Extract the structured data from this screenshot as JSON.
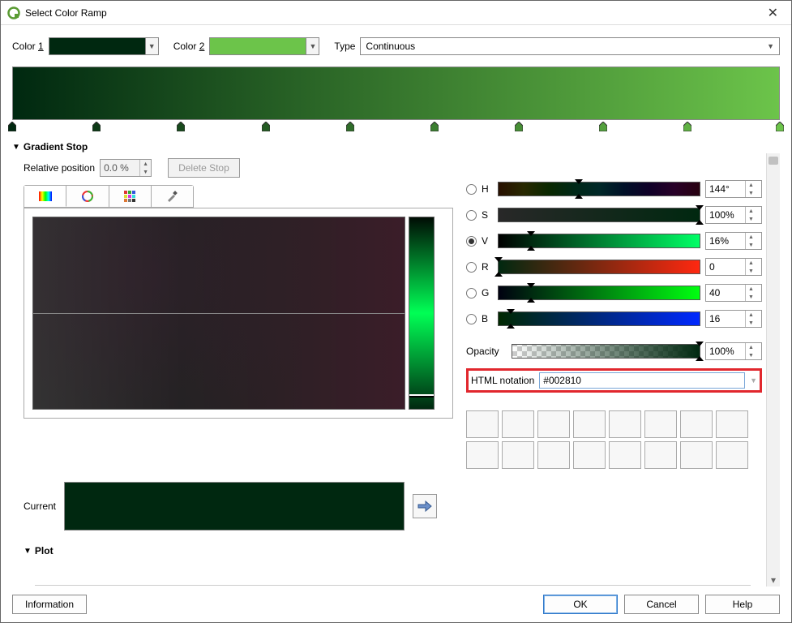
{
  "window": {
    "title": "Select Color Ramp"
  },
  "top": {
    "color1_label_pre": "Color ",
    "color1_u": "1",
    "color2_label_pre": "Color ",
    "color2_u": "2",
    "color1": "#002810",
    "color2": "#6cc44a",
    "type_label": "Type",
    "type_value": "Continuous"
  },
  "gradient": {
    "stops_pct": [
      0,
      11,
      22,
      33,
      44,
      55,
      66,
      77,
      88,
      100
    ]
  },
  "section1": {
    "title": "Gradient Stop"
  },
  "stop": {
    "relpos_label": "Relative position",
    "relpos_value": "0.0 %",
    "delete_label": "Delete Stop"
  },
  "channels": {
    "h": {
      "label": "H",
      "value": "144°",
      "grad": "linear-gradient(to right,#281000,#282800,#0a2800,#002817,#002828,#001028,#100028,#280028,#280010)",
      "mk": 40
    },
    "s": {
      "label": "S",
      "value": "100%",
      "grad": "linear-gradient(to right,#282828,#002810)",
      "mk": 100
    },
    "v": {
      "label": "V",
      "value": "16%",
      "grad": "linear-gradient(to right,#000000,#00ff66)",
      "mk": 16,
      "selected": true
    },
    "r": {
      "label": "R",
      "value": "0",
      "grad": "linear-gradient(to right,#002810,#ff2810)",
      "mk": 0
    },
    "g": {
      "label": "G",
      "value": "40",
      "grad": "linear-gradient(to right,#000010,#00ff10)",
      "mk": 16
    },
    "b": {
      "label": "B",
      "value": "16",
      "grad": "linear-gradient(to right,#002800,#0028ff)",
      "mk": 6
    }
  },
  "opacity": {
    "label": "Opacity",
    "value": "100%",
    "mk": 100
  },
  "html": {
    "label": "HTML notation",
    "value": "#002810"
  },
  "current": {
    "label": "Current",
    "color": "#002810"
  },
  "section2": {
    "title": "Plot"
  },
  "footer": {
    "info": "Information",
    "ok": "OK",
    "cancel": "Cancel",
    "help": "Help"
  }
}
